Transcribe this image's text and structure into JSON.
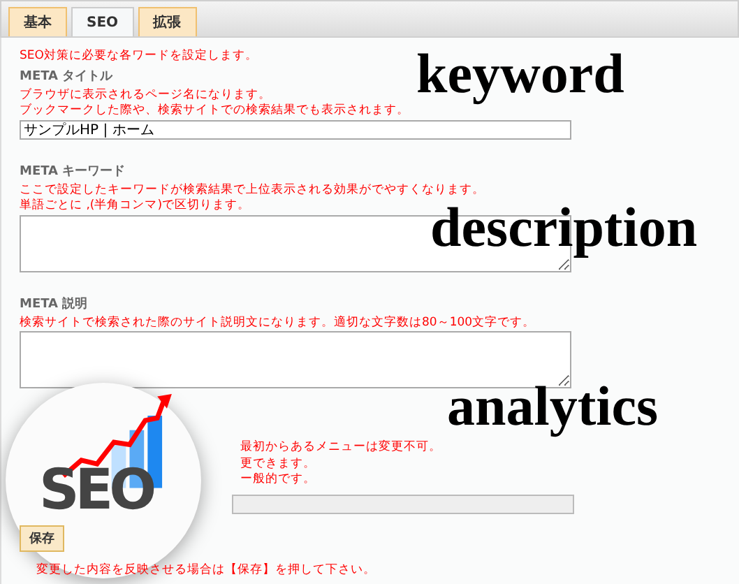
{
  "tabs": [
    {
      "label": "基本",
      "selected": false
    },
    {
      "label": "SEO",
      "selected": true
    },
    {
      "label": "拡張",
      "selected": false
    }
  ],
  "intro": "SEO対策に必要な各ワードを設定します。",
  "sections": [
    {
      "label": "META タイトル",
      "notes": [
        "ブラウザに表示されるページ名になります。",
        "ブックマークした際や、検索サイトでの検索結果でも表示されます。"
      ],
      "kind": "input",
      "value": "サンプルHP | ホーム"
    },
    {
      "label": "META キーワード",
      "notes": [
        "ここで設定したキーワードが検索結果で上位表示される効果がでやすくなります。",
        "単語ごとに ,(半角コンマ)で区切ります。"
      ],
      "kind": "textarea"
    },
    {
      "label": "META 説明",
      "notes": [
        "検索サイトで検索された際のサイト説明文になります。適切な文字数は80～100文字です。"
      ],
      "kind": "textarea"
    }
  ],
  "url_notes": [
    "最初からあるメニューは変更不可。",
    "更できます。",
    "ー般的です。"
  ],
  "save_button": "保存",
  "footer_note": "変更した内容を反映させる場合は【保存】を押して下さい。",
  "overlay_words": [
    "keyword",
    "description",
    "analytics"
  ],
  "logo_text": "SEO"
}
